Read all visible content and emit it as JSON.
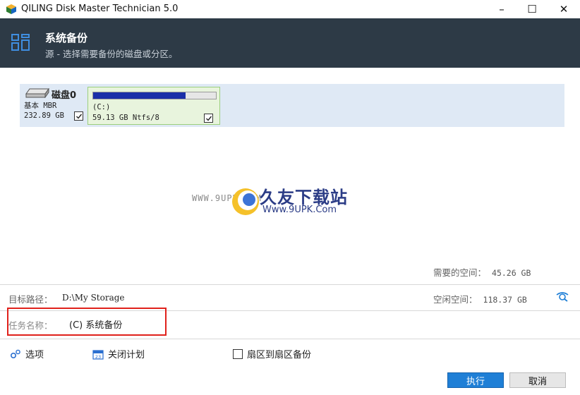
{
  "window": {
    "title": "QILING Disk Master Technician 5.0",
    "minimize": "–",
    "maximize": "☐",
    "close": "✕"
  },
  "header": {
    "title": "系统备份",
    "subtitle": "源 - 选择需要备份的磁盘或分区。",
    "icon": "grid-icon"
  },
  "disk": {
    "name": "磁盘0",
    "type": "基本 MBR",
    "size": "232.89 GB",
    "checked": true,
    "partition": {
      "label": "(C:)",
      "info": "59.13 GB Ntfs/8",
      "used_fraction": 0.75,
      "checked": true,
      "bar_color": "#1b2fa8"
    }
  },
  "watermark": {
    "small": "WWW.9UPK.COM",
    "title": "久友下载站",
    "url": "Www.9UPK.Com"
  },
  "space": {
    "required_label": "需要的空间：",
    "required_value": "45.26 GB",
    "free_label": "空闲空间：",
    "free_value": "118.37 GB"
  },
  "target": {
    "label": "目标路径：",
    "value": "D:\\My Storage"
  },
  "task": {
    "label": "任务名称：",
    "value": "(C) 系统备份"
  },
  "options": {
    "options_label": "选项",
    "schedule_label": "关闭计划",
    "sector_label": "扇区到扇区备份"
  },
  "buttons": {
    "execute": "执行",
    "cancel": "取消"
  },
  "colors": {
    "header_bg": "#2d3a46",
    "accent": "#1f7fd6",
    "highlight_border": "#e0211b"
  }
}
